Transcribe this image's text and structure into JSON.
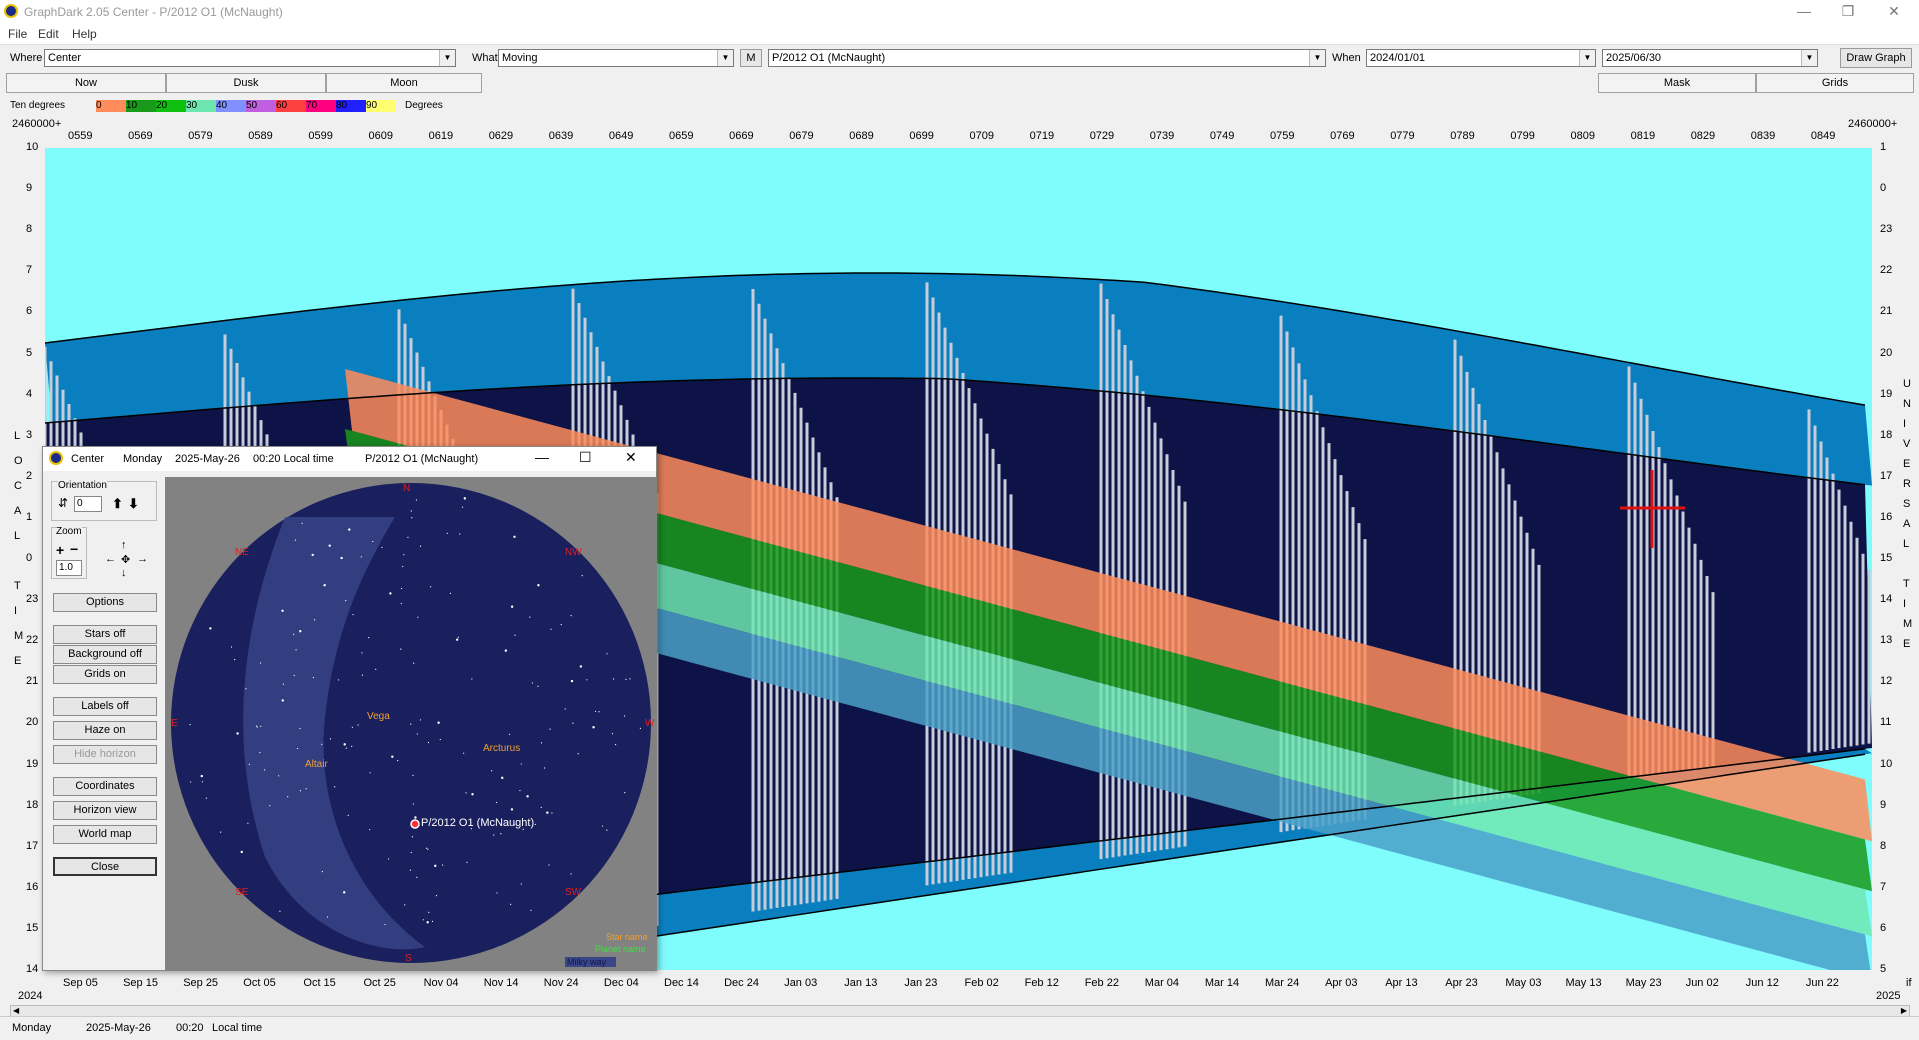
{
  "window": {
    "title": "GraphDark 2.05  Center  -  P/2012 O1 (McNaught)",
    "controls": [
      "—",
      "❐",
      "✕"
    ]
  },
  "menu": [
    "File",
    "Edit",
    "Help"
  ],
  "toolbar": {
    "where_label": "Where",
    "where_value": "Center",
    "what_label": "What",
    "what_value": "Moving",
    "m_button": "M",
    "object_value": "P/2012 O1 (McNaught)",
    "when_label": "When",
    "start_date": "2024/01/01",
    "end_date": "2025/06/30",
    "draw_graph": "Draw Graph"
  },
  "tabs": {
    "now": "Now",
    "dusk": "Dusk",
    "moon": "Moon",
    "mask": "Mask",
    "grids": "Grids"
  },
  "legend": {
    "title": "Ten degrees",
    "units": "Degrees",
    "swatches": [
      {
        "label": "0",
        "color": "#ff8c5a"
      },
      {
        "label": "10",
        "color": "#1a9a1a"
      },
      {
        "label": "20",
        "color": "#10c010"
      },
      {
        "label": "30",
        "color": "#6ee6b0"
      },
      {
        "label": "40",
        "color": "#8090ff"
      },
      {
        "label": "50",
        "color": "#c060e0"
      },
      {
        "label": "60",
        "color": "#ff4040"
      },
      {
        "label": "70",
        "color": "#ff0080"
      },
      {
        "label": "80",
        "color": "#2020ff"
      },
      {
        "label": "90",
        "color": "#ffff70"
      }
    ]
  },
  "axes": {
    "jd_prefix_left": "2460000+",
    "jd_prefix_right": "2460000+",
    "jd_ticks": [
      "0559",
      "0569",
      "0579",
      "0589",
      "0599",
      "0609",
      "0619",
      "0629",
      "0639",
      "0649",
      "0659",
      "0669",
      "0679",
      "0689",
      "0699",
      "0709",
      "0719",
      "0729",
      "0739",
      "0749",
      "0759",
      "0769",
      "0779",
      "0789",
      "0799",
      "0809",
      "0819",
      "0829",
      "0839",
      "0849"
    ],
    "left_ticks": [
      "10",
      "9",
      "8",
      "7",
      "6",
      "5",
      "4",
      "3",
      "2",
      "1",
      "0",
      "23",
      "22",
      "21",
      "20",
      "19",
      "18",
      "17",
      "16",
      "15",
      "14"
    ],
    "right_ticks": [
      "1",
      "0",
      "23",
      "22",
      "21",
      "20",
      "19",
      "18",
      "17",
      "16",
      "15",
      "14",
      "13",
      "12",
      "11",
      "10",
      "9",
      "8",
      "7",
      "6",
      "5"
    ],
    "left_vertical_label": [
      "L",
      "O",
      "C",
      "A",
      "L",
      "",
      "T",
      "I",
      "M",
      "E"
    ],
    "right_vertical_label": [
      "U",
      "N",
      "I",
      "V",
      "E",
      "R",
      "S",
      "A",
      "L",
      "",
      "T",
      "I",
      "M",
      "E"
    ],
    "date_ticks": [
      "Sep 05",
      "Sep 15",
      "Sep 25",
      "Oct 05",
      "Oct 15",
      "Oct 25",
      "Nov 04",
      "Nov 14",
      "Nov 24",
      "Dec 04",
      "Dec 14",
      "Dec 24",
      "Jan 03",
      "Jan 13",
      "Jan 23",
      "Feb 02",
      "Feb 12",
      "Feb 22",
      "Mar 04",
      "Mar 14",
      "Mar 24",
      "Apr 03",
      "Apr 13",
      "Apr 23",
      "May 03",
      "May 13",
      "May 23",
      "Jun 02",
      "Jun 12",
      "Jun 22"
    ],
    "year_left": "2024",
    "year_right": "2025",
    "corner_right": "if"
  },
  "status": {
    "day": "Monday",
    "date": "2025-May-26",
    "time": "00:20",
    "tz": "Local time"
  },
  "sky_window": {
    "location": "Center",
    "day": "Monday",
    "date": "2025-May-26",
    "time": "00:20 Local time",
    "object": "P/2012 O1 (McNaught)",
    "controls": [
      "—",
      "☐",
      "✕"
    ],
    "orientation_label": "Orientation",
    "orientation_value": "0",
    "zoom_label": "Zoom",
    "zoom_value": "1.0",
    "buttons": [
      "Options",
      "Stars off",
      "Background off",
      "Grids on",
      "Labels off",
      "Haze on",
      "Hide horizon",
      "Coordinates",
      "Horizon view",
      "World map",
      "Close"
    ],
    "compass": {
      "n": "N",
      "ne": "NE",
      "nw": "NW",
      "e": "E",
      "w": "W",
      "se": "SE",
      "sw": "SW",
      "s": "S"
    },
    "stars": [
      "Vega",
      "Arcturus",
      "Altair"
    ],
    "target_label": "P/2012 O1 (McNaught)",
    "key": [
      "Star name",
      "Planet name",
      "Milky way"
    ],
    "colors": {
      "sky": "#1a1f5e",
      "milky": "#3a4688",
      "star_label": "#f0a030",
      "compass": "#e02020",
      "key_planet": "#40e040"
    }
  },
  "colors": {
    "plot_bg": "#7ffcfc",
    "night": "#0d1346",
    "twilight_blue": "#0a7fc0",
    "stripe_gray": "#c8ccd8"
  }
}
